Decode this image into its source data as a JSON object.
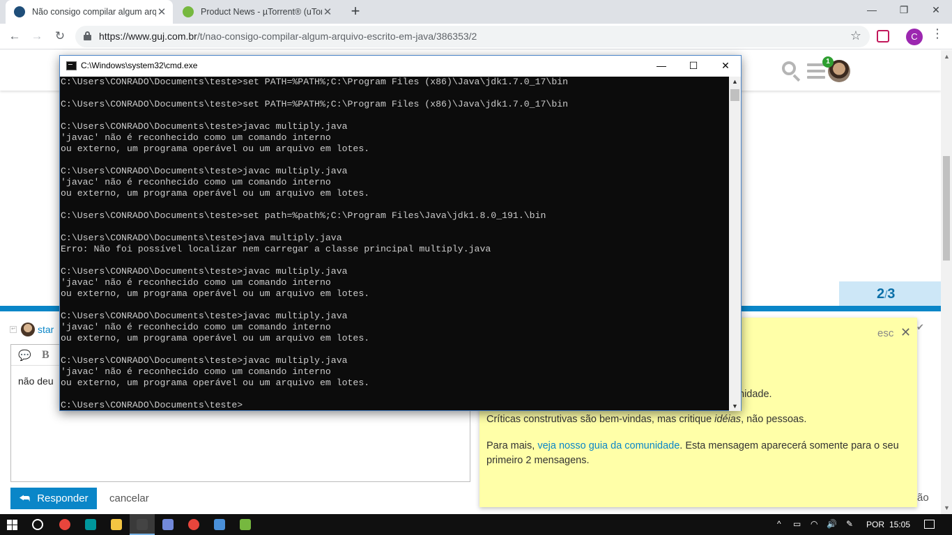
{
  "browser": {
    "tabs": [
      {
        "title": "Não consigo compilar algum arq",
        "favicon_color": "#1f4e79",
        "active": true
      },
      {
        "title": "Product News - µTorrent® (uTor",
        "favicon_color": "#76b83f",
        "active": false
      }
    ],
    "new_tab_label": "+",
    "window_controls": {
      "minimize": "—",
      "restore": "❐",
      "close": "✕"
    },
    "nav": {
      "back": "←",
      "forward": "→",
      "reload": "↻"
    },
    "url_host": "https://www.guj.com.br",
    "url_path": "/t/nao-consigo-compilar-algum-arquivo-escrito-em-java/386353/2",
    "bookmark_star": "☆",
    "profile_initial": "C",
    "menu": "⋮"
  },
  "site": {
    "notification_count": "1",
    "progress": {
      "current": "2",
      "separator": "/",
      "total": "3"
    },
    "composer": {
      "reply_to_user": "star",
      "editor_text": "não deu",
      "reply_button": "Responder",
      "reply_icon": "⮪",
      "cancel": "cancelar",
      "quote_icon": "💬",
      "bold_label": "B"
    },
    "right_partial_text": "ão",
    "check_icon": "✔"
  },
  "notice": {
    "esc_label": "esc",
    "close_label": "✕",
    "line1_partial": "nidade.",
    "p2_before": "Críticas construtivas são bem-vindas, mas critique ",
    "p2_em": "idéias",
    "p2_after": ", não pessoas.",
    "p3_before": "Para mais, ",
    "p3_link": "veja nosso guia da comunidade",
    "p3_after": ". Esta mensagem aparecerá somente para o seu primeiro 2 mensagens."
  },
  "cmd": {
    "title": "C:\\Windows\\system32\\cmd.exe",
    "controls": {
      "minimize": "—",
      "maximize": "☐",
      "close": "✕"
    },
    "lines": [
      "C:\\Users\\CONRADO\\Documents\\teste>set PATH=%PATH%;C:\\Program Files (x86)\\Java\\jdk1.7.0_17\\bin",
      "",
      "C:\\Users\\CONRADO\\Documents\\teste>set PATH=%PATH%;C:\\Program Files (x86)\\Java\\jdk1.7.0_17\\bin",
      "",
      "C:\\Users\\CONRADO\\Documents\\teste>javac multiply.java",
      "'javac' não é reconhecido como um comando interno",
      "ou externo, um programa operável ou um arquivo em lotes.",
      "",
      "C:\\Users\\CONRADO\\Documents\\teste>javac multiply.java",
      "'javac' não é reconhecido como um comando interno",
      "ou externo, um programa operável ou um arquivo em lotes.",
      "",
      "C:\\Users\\CONRADO\\Documents\\teste>set path=%path%;C:\\Program Files\\Java\\jdk1.8.0_191.\\bin",
      "",
      "C:\\Users\\CONRADO\\Documents\\teste>java multiply.java",
      "Erro: Não foi possível localizar nem carregar a classe principal multiply.java",
      "",
      "C:\\Users\\CONRADO\\Documents\\teste>javac multiply.java",
      "'javac' não é reconhecido como um comando interno",
      "ou externo, um programa operável ou um arquivo em lotes.",
      "",
      "C:\\Users\\CONRADO\\Documents\\teste>javac multiply.java",
      "'javac' não é reconhecido como um comando interno",
      "ou externo, um programa operável ou um arquivo em lotes.",
      "",
      "C:\\Users\\CONRADO\\Documents\\teste>javac multiply.java",
      "'javac' não é reconhecido como um comando interno",
      "ou externo, um programa operável ou um arquivo em lotes.",
      "",
      "C:\\Users\\CONRADO\\Documents\\teste>"
    ]
  },
  "taskbar": {
    "apps": [
      {
        "name": "chrome",
        "color": "#e8453c",
        "active": false
      },
      {
        "name": "arduino",
        "color": "#00979c",
        "active": false
      },
      {
        "name": "file-explorer",
        "color": "#f4c542",
        "active": false
      },
      {
        "name": "cmd",
        "color": "#444444",
        "active": true
      },
      {
        "name": "discord",
        "color": "#7289da",
        "active": false
      },
      {
        "name": "chrome-alt",
        "color": "#e8453c",
        "active": false
      },
      {
        "name": "monitor",
        "color": "#4a90d9",
        "active": false
      },
      {
        "name": "utorrent",
        "color": "#76b83f",
        "active": false
      }
    ],
    "tray": {
      "chevron": "^",
      "battery": "▭",
      "wifi": "◠",
      "volume": "🔊",
      "pen": "✎"
    },
    "language": "POR",
    "time": "15:05"
  }
}
